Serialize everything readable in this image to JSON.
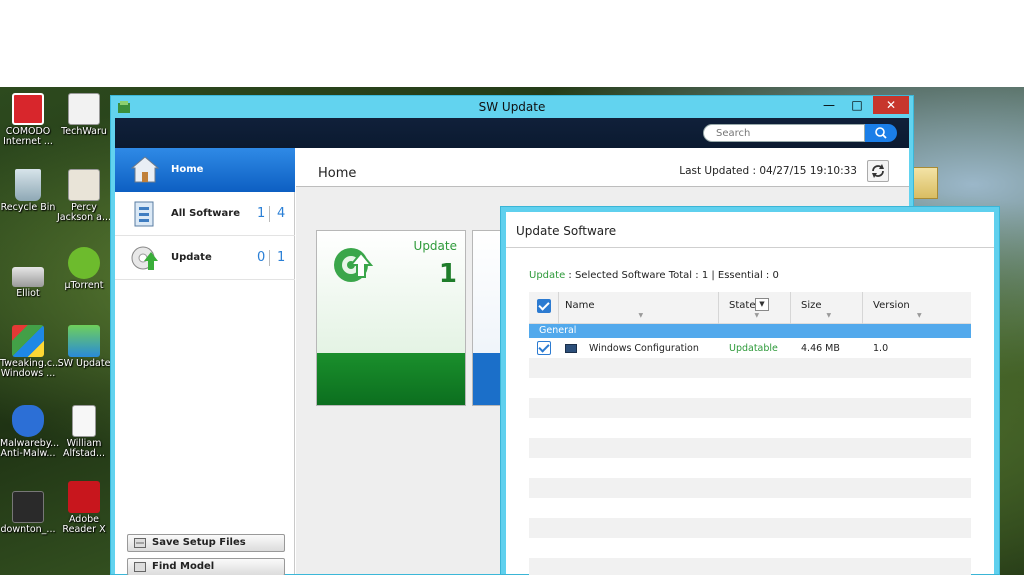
{
  "desktop": {
    "icons": [
      {
        "label": "COMODO Internet ..."
      },
      {
        "label": "TechWaru"
      },
      {
        "label": "Recycle Bin"
      },
      {
        "label": "Percy Jackson a..."
      },
      {
        "label": "Elliot"
      },
      {
        "label": "µTorrent"
      },
      {
        "label": "Tweaking.c... Windows ..."
      },
      {
        "label": "SW Update"
      },
      {
        "label": "Malwareby... Anti-Malw..."
      },
      {
        "label": "William Alfstad..."
      },
      {
        "label": "downton_..."
      },
      {
        "label": "Adobe Reader X"
      }
    ]
  },
  "window": {
    "title": "SW Update",
    "min_glyph": "—",
    "max_glyph": "□",
    "close_glyph": "✕"
  },
  "search": {
    "placeholder": "Search"
  },
  "sidebar": {
    "items": [
      {
        "label": "Home"
      },
      {
        "label": "All Software",
        "count1": "1",
        "count2": "4"
      },
      {
        "label": "Update",
        "count1": "0",
        "count2": "1"
      }
    ],
    "save_button": "Save Setup Files",
    "find_button": "Find Model"
  },
  "main": {
    "title": "Home",
    "last_updated": "Last Updated : 04/27/15 19:10:33",
    "tile_update": {
      "label": "Update",
      "count": "1"
    }
  },
  "dialog": {
    "title": "Update Software",
    "summary_prefix": "Update",
    "summary_rest": " : Selected Software Total : 1 | Essential : 0",
    "columns": {
      "name": "Name",
      "state": "State",
      "size": "Size",
      "version": "Version"
    },
    "group": "General",
    "rows": [
      {
        "name": "Windows Configuration",
        "state": "Updatable",
        "size": "4.46 MB",
        "version": "1.0"
      }
    ]
  },
  "colors": {
    "accent_blue": "#2c7bd1",
    "window_frame": "#62d3ef",
    "status_green": "#2e9a3a",
    "close_red": "#c7362c"
  }
}
